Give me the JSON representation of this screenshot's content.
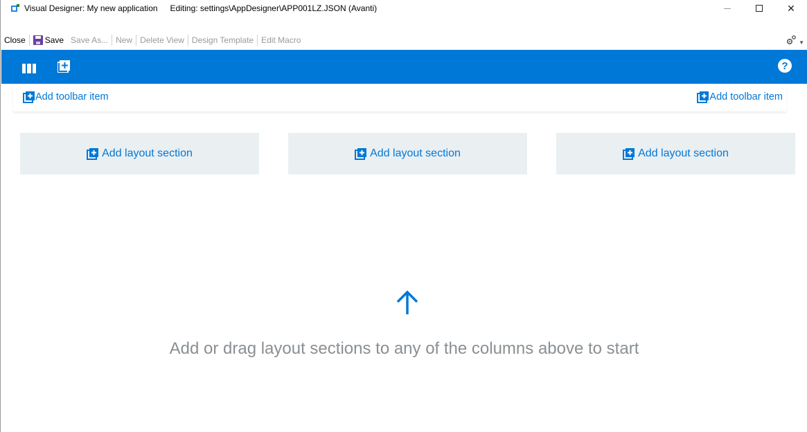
{
  "titlebar": {
    "app_title": "Visual Designer: My new application",
    "editing": "Editing: settings\\AppDesigner\\APP001LZ.JSON (Avanti)",
    "minimize_label": "—",
    "close_label": "✕"
  },
  "menubar": {
    "close_label": "Close",
    "save_label": "Save",
    "save_as_label": "Save As...",
    "new_label": "New",
    "delete_view_label": "Delete View",
    "design_template_label": "Design Template",
    "edit_macro_label": "Edit Macro",
    "settings_icon": "gear-icon"
  },
  "ribbon": {
    "color": "#0078d7",
    "columns_icon": "columns-icon",
    "add_icon": "add-box-icon",
    "help_label": "?"
  },
  "toolstrip": {
    "left_add_label": "Add toolbar item",
    "right_add_label": "Add toolbar item"
  },
  "sections": [
    {
      "label": "Add layout section"
    },
    {
      "label": "Add layout section"
    },
    {
      "label": "Add layout section"
    }
  ],
  "hint": {
    "text": "Add or drag layout sections to any of the columns above to start",
    "icon": "arrow-up-icon"
  }
}
